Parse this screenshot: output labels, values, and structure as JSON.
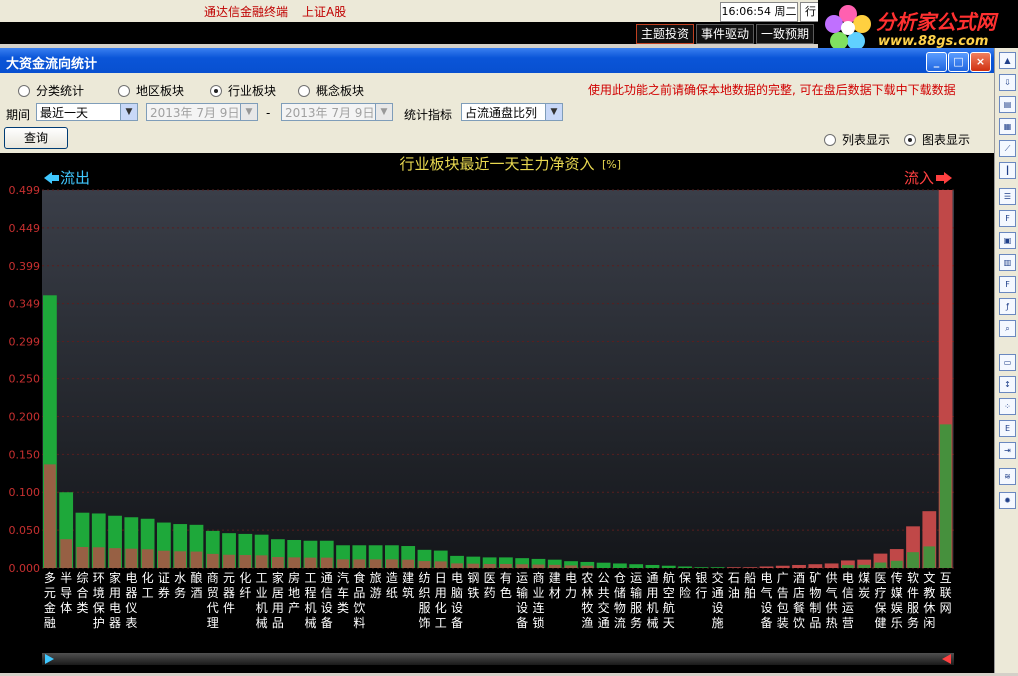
{
  "topbar": {
    "app_name": "通达信金融终端",
    "market": "上证A股",
    "clock": "16:06:54 周二",
    "top_button": "行"
  },
  "tabs": [
    "主题投资",
    "事件驱动",
    "一致预期"
  ],
  "logo": {
    "name": "分析家公式网",
    "url": "www.88gs.com"
  },
  "window": {
    "title": "大资金流向统计",
    "minimize": "_",
    "maximize": "□",
    "close": "×"
  },
  "controls": {
    "radios": [
      {
        "label": "分类统计",
        "selected": false
      },
      {
        "label": "地区板块",
        "selected": false
      },
      {
        "label": "行业板块",
        "selected": true
      },
      {
        "label": "概念板块",
        "selected": false
      }
    ],
    "period_label": "期间",
    "period_value": "最近一天",
    "date_from": "2013年 7月 9日",
    "date_sep": "-",
    "date_to": "2013年 7月 9日",
    "metric_label": "统计指标",
    "metric_value": "占流通盘比列",
    "warning": "使用此功能之前请确保本地数据的完整, 可在盘后数据下载中下载数据",
    "query_button": "查询",
    "view_list": "列表显示",
    "view_chart": "图表显示",
    "view_mode": "chart"
  },
  "chart_data": {
    "type": "bar",
    "title": "行业板块最近一天主力净资入",
    "unit_badge": "[%]",
    "outflow_label": "流出",
    "inflow_label": "流入",
    "ylim": [
      0,
      0.499
    ],
    "yticks": [
      "0.499",
      "0.449",
      "0.399",
      "0.349",
      "0.299",
      "0.250",
      "0.200",
      "0.150",
      "0.100",
      "0.050",
      "0.000"
    ],
    "categories": [
      "多元金融",
      "半导体",
      "综合类",
      "环境保护",
      "家用电器",
      "电器仪表",
      "化工",
      "证券",
      "水务",
      "酿酒",
      "商贸代理",
      "元器件",
      "化纤",
      "工业机械",
      "家居用品",
      "房地产",
      "工程机械",
      "通信设备",
      "汽车类",
      "食品饮料",
      "旅游",
      "造纸",
      "建筑",
      "纺织服饰",
      "日用化工",
      "电脑设备",
      "钢铁",
      "医药",
      "有色",
      "运输设备",
      "商业连锁",
      "建材",
      "电力",
      "农林牧渔",
      "公共交通",
      "仓储物流",
      "运输服务",
      "通用机械",
      "航空航天",
      "保险",
      "银行",
      "交通设施",
      "石油",
      "船舶",
      "电气设备",
      "广告包装",
      "酒店餐饮",
      "矿物制品",
      "供气供热",
      "电信运营",
      "煤炭",
      "医疗保健",
      "传媒娱乐",
      "软件服务",
      "文教休闲",
      "互联网"
    ],
    "values": [
      -0.36,
      -0.1,
      -0.073,
      -0.072,
      -0.069,
      -0.067,
      -0.065,
      -0.06,
      -0.058,
      -0.057,
      -0.049,
      -0.046,
      -0.045,
      -0.044,
      -0.038,
      -0.037,
      -0.036,
      -0.036,
      -0.03,
      -0.03,
      -0.03,
      -0.03,
      -0.029,
      -0.024,
      -0.023,
      -0.016,
      -0.015,
      -0.014,
      -0.014,
      -0.013,
      -0.012,
      -0.011,
      -0.009,
      -0.008,
      -0.007,
      -0.006,
      -0.005,
      -0.004,
      -0.003,
      -0.002,
      -0.001,
      -0.001,
      0.001,
      0.001,
      0.002,
      0.003,
      0.004,
      0.005,
      0.006,
      0.01,
      0.011,
      0.019,
      0.025,
      0.055,
      0.075,
      0.499
    ],
    "colors": {
      "outflow": "#1ea83a",
      "outflow_light": "#62d070",
      "inflow": "#c04848",
      "inflow_light": "#e88080",
      "axis_text": "#c83030",
      "title": "#e8d850",
      "plot_bg": "#20242c"
    }
  }
}
